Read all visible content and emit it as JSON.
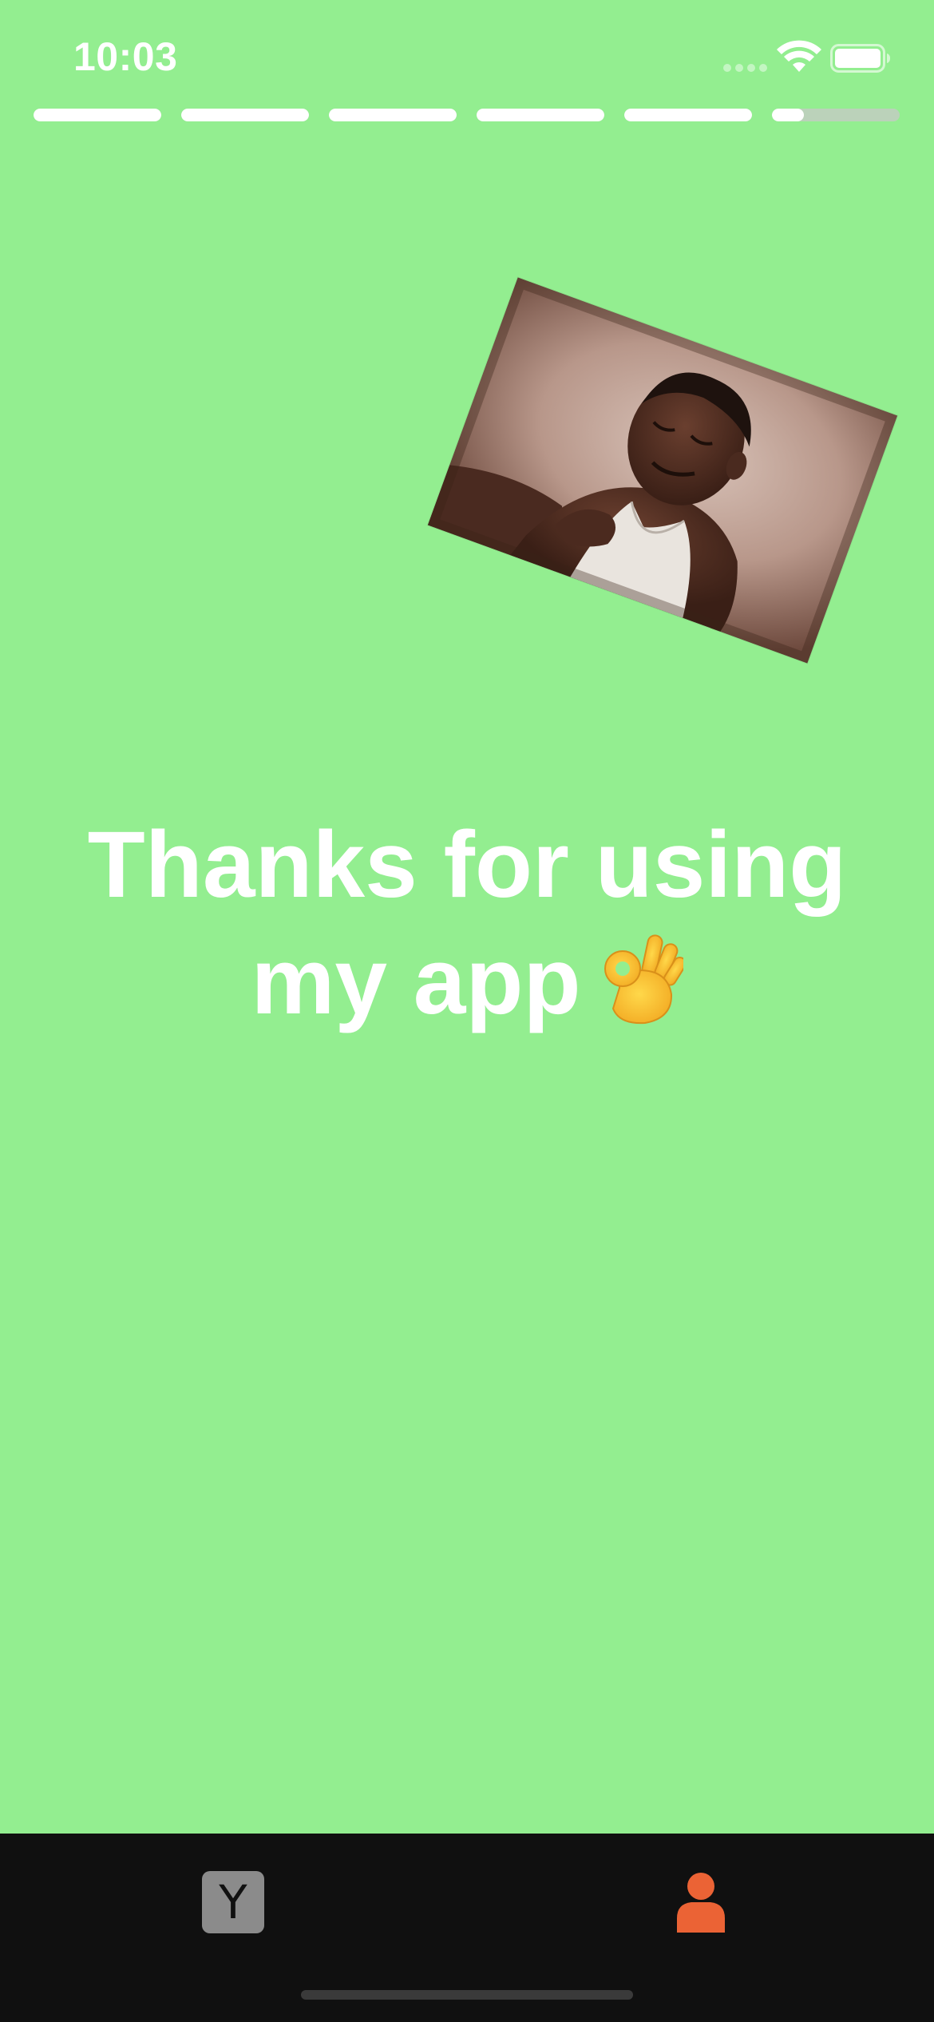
{
  "status_bar": {
    "time": "10:03",
    "signal_icon": "signal-dots-icon",
    "wifi_icon": "wifi-icon",
    "battery_icon": "battery-icon"
  },
  "story_progress": {
    "segments": [
      1,
      1,
      1,
      1,
      1,
      0.25
    ],
    "active_index": 5,
    "filled_color": "#ffffff",
    "track_color": "#d4d4d4"
  },
  "story": {
    "background_color": "#93ee90",
    "image": "photo of a smiling child in a white tank top",
    "message_line_1": "Thanks for using",
    "message_line_2": "my app",
    "message_emoji": "ok-hand-icon"
  },
  "tab_bar": {
    "tabs": [
      {
        "name": "tab-hacker-news",
        "label": "Y",
        "icon": "y-logo-icon",
        "active": false
      },
      {
        "name": "tab-profile",
        "icon": "person-icon",
        "active": true,
        "active_color": "#eb6335"
      }
    ]
  }
}
